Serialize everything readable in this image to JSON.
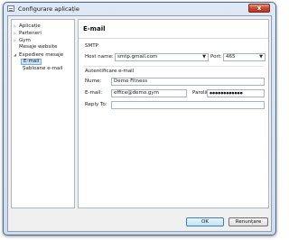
{
  "window": {
    "title": "Configurare aplicație",
    "close_label": "x"
  },
  "tree": {
    "items": [
      {
        "label": "Aplicație",
        "arrow": "▷"
      },
      {
        "label": "Parteneri",
        "arrow": "▷"
      },
      {
        "label": "Gym",
        "arrow": "▷"
      },
      {
        "label": "Mesaje website",
        "arrow": ""
      },
      {
        "label": "Expediere mesaje",
        "arrow": "◢"
      },
      {
        "label": "E-mail",
        "arrow": ""
      },
      {
        "label": "Șabloane e-mail",
        "arrow": ""
      }
    ],
    "selected": "E-mail"
  },
  "panel": {
    "title": "E-mail",
    "smtp": {
      "section_label": "SMTP",
      "host_label": "Host name:",
      "host_value": "smtp.gmail.com",
      "port_label": "Port:",
      "port_value": "465"
    },
    "auth": {
      "section_label": "Autentificare e-mail",
      "name_label": "Nume:",
      "name_value": "Demo Fitness",
      "email_label": "E-mail:",
      "email_value": "office@demo.gym",
      "password_label": "Parolă:",
      "password_value": "●●●●●●●●●●●●",
      "reply_label": "Reply To:",
      "reply_value": ""
    }
  },
  "buttons": {
    "ok": "OK",
    "cancel": "Renunțare"
  }
}
